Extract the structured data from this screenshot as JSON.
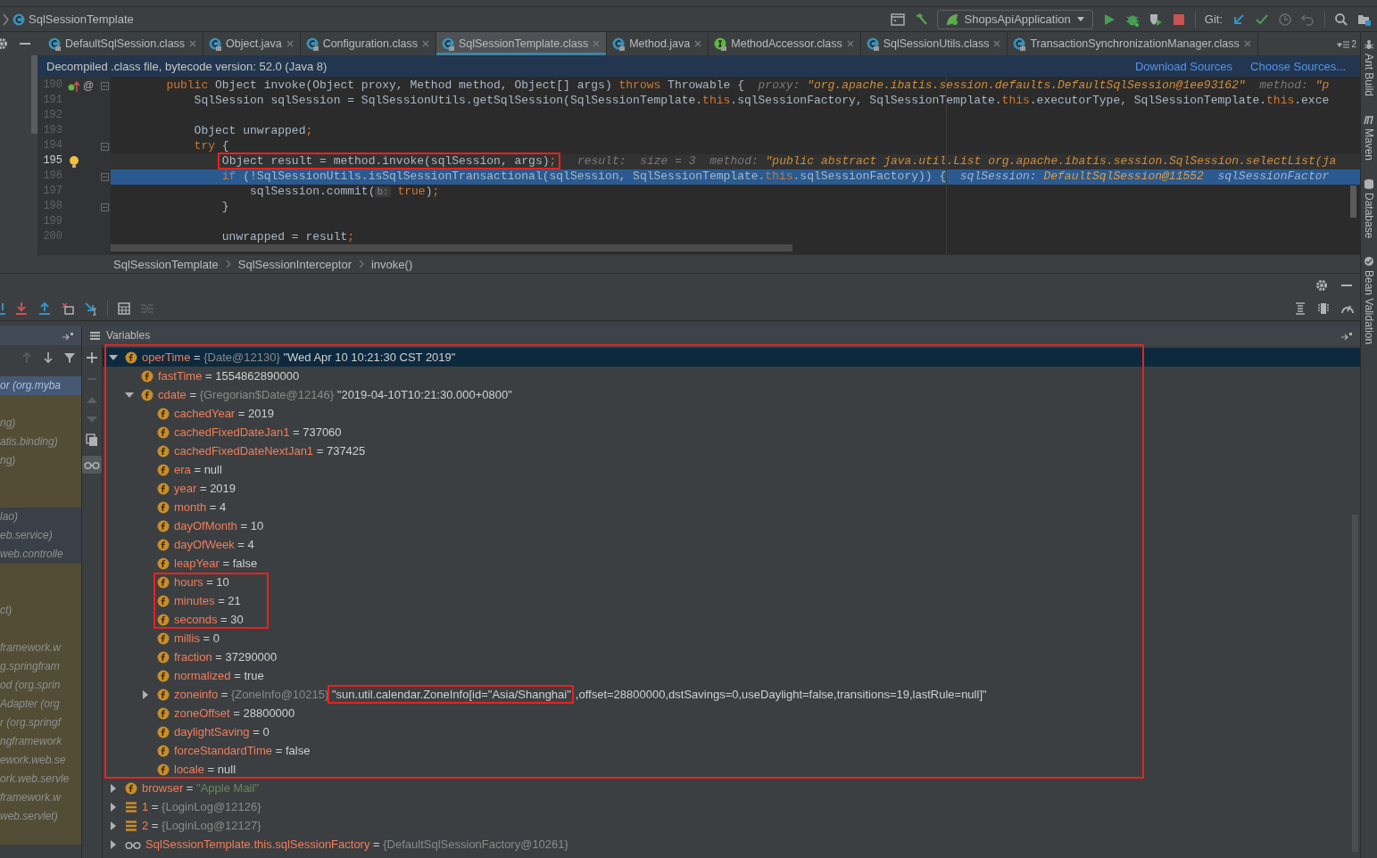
{
  "navbar": {
    "breadcrumb": "SqlSessionTemplate",
    "run_config": "ShopsApiApplication",
    "vcs_label": "Git:"
  },
  "tabs": [
    {
      "label": "DefaultSqlSession.class",
      "kind": "class",
      "selected": false
    },
    {
      "label": "Object.java",
      "kind": "class",
      "selected": false
    },
    {
      "label": "Configuration.class",
      "kind": "class",
      "selected": false
    },
    {
      "label": "SqlSessionTemplate.class",
      "kind": "class",
      "selected": true
    },
    {
      "label": "Method.java",
      "kind": "class",
      "selected": false
    },
    {
      "label": "MethodAccessor.class",
      "kind": "interface",
      "selected": false
    },
    {
      "label": "SqlSessionUtils.class",
      "kind": "class",
      "selected": false
    },
    {
      "label": "TransactionSynchronizationManager.class",
      "kind": "class",
      "selected": false
    }
  ],
  "hidden_tabs_count": "2",
  "banner": {
    "message": "Decompiled .class file, bytecode version: 52.0 (Java 8)",
    "links": [
      "Download Sources",
      "Choose Sources..."
    ]
  },
  "code_lines": [
    {
      "number": "190",
      "override": true,
      "gutter_mark": "@",
      "fold": true,
      "current": false,
      "execution_point": false,
      "segments": [
        {
          "kind": "keyword",
          "text": "        public"
        },
        {
          "kind": "plain",
          "text": " Object invoke(Object proxy, Method method, Object[] args) "
        },
        {
          "kind": "keyword",
          "text": "throws"
        },
        {
          "kind": "plain",
          "text": " Throwable {"
        },
        {
          "kind": "hint",
          "text": "  proxy: "
        },
        {
          "kind": "hint_value",
          "text": "\"org.apache.ibatis.session.defaults.DefaultSqlSession@1ee93162\""
        },
        {
          "kind": "hint",
          "text": "  method: "
        },
        {
          "kind": "hint_value",
          "text": "\"p"
        }
      ]
    },
    {
      "number": "191",
      "fold": false,
      "current": false,
      "execution_point": false,
      "segments": [
        {
          "kind": "plain",
          "text": "            SqlSession sqlSession = SqlSessionUtils.getSqlSession(SqlSessionTemplate."
        },
        {
          "kind": "keyword",
          "text": "this"
        },
        {
          "kind": "plain",
          "text": ".sqlSessionFactory, SqlSessionTemplate."
        },
        {
          "kind": "keyword",
          "text": "this"
        },
        {
          "kind": "plain",
          "text": ".executorType, SqlSessionTemplate."
        },
        {
          "kind": "keyword",
          "text": "this"
        },
        {
          "kind": "plain",
          "text": ".exce"
        }
      ]
    },
    {
      "number": "192"
    },
    {
      "number": "193",
      "fold": false,
      "current": false,
      "execution_point": false,
      "segments": [
        {
          "kind": "plain",
          "text": "            Object unwrapped"
        },
        {
          "kind": "keyword",
          "text": ";"
        }
      ]
    },
    {
      "number": "194",
      "fold": true,
      "current": false,
      "execution_point": false,
      "segments": [
        {
          "kind": "keyword",
          "text": "            try"
        },
        {
          "kind": "plain",
          "text": " {"
        }
      ]
    },
    {
      "number": "195",
      "intention": true,
      "fold": false,
      "current": true,
      "execution_point": false,
      "segments": [
        {
          "kind": "plain",
          "text": "                Object result = method.invoke(sqlSession, args)",
          "boxed": true
        },
        {
          "kind": "keyword",
          "text": ";",
          "boxed": true
        },
        {
          "kind": "hint",
          "text": "  result:  size = 3  method: "
        },
        {
          "kind": "hint_value",
          "text": "\"public abstract java.util.List org.apache.ibatis.session.SqlSession.selectList(ja"
        }
      ]
    },
    {
      "number": "196",
      "fold": true,
      "current": false,
      "execution_point": true,
      "segments": [
        {
          "kind": "keyword",
          "text": "                if"
        },
        {
          "kind": "plain",
          "text": " (!SqlSessionUtils.isSqlSessionTransactional(sqlSession, SqlSessionTemplate."
        },
        {
          "kind": "keyword",
          "text": "this"
        },
        {
          "kind": "plain",
          "text": ".sqlSessionFactory)) {"
        },
        {
          "kind": "hint",
          "text": "  sqlSession: "
        },
        {
          "kind": "hint_value",
          "text": "DefaultSqlSession@11552"
        },
        {
          "kind": "hint",
          "text": "  sqlSessionFactor"
        }
      ]
    },
    {
      "number": "197",
      "fold": false,
      "current": false,
      "execution_point": false,
      "segments": [
        {
          "kind": "plain",
          "text": "                    sqlSession.commit("
        },
        {
          "kind": "param_hint",
          "text": "b:"
        },
        {
          "kind": "keyword",
          "text": " true"
        },
        {
          "kind": "plain",
          "text": ")"
        },
        {
          "kind": "keyword",
          "text": ";"
        }
      ]
    },
    {
      "number": "198",
      "fold": true,
      "current": false,
      "execution_point": false,
      "segments": [
        {
          "kind": "plain",
          "text": "                }"
        }
      ]
    },
    {
      "number": "199"
    },
    {
      "number": "200",
      "fold": false,
      "current": false,
      "execution_point": false,
      "segments": [
        {
          "kind": "plain",
          "text": "                unwrapped = result"
        },
        {
          "kind": "keyword",
          "text": ";"
        }
      ]
    }
  ],
  "breadcrumbs": [
    "SqlSessionTemplate",
    "SqlSessionInterceptor",
    "invoke()"
  ],
  "variables_title": "Variables",
  "frames": [
    {
      "text": "or (org.myba",
      "library": false,
      "selected": true
    },
    {
      "library": true,
      "selected": false
    },
    {
      "text": "ng)",
      "library": true,
      "selected": false
    },
    {
      "text": "atis.binding)",
      "library": true,
      "selected": false
    },
    {
      "text": "ng)",
      "library": true,
      "selected": false
    },
    {
      "library": true,
      "selected": false
    },
    {
      "library": true,
      "selected": false
    },
    {
      "text": "lao)",
      "library": false,
      "selected": false
    },
    {
      "text": "eb.service)",
      "library": false,
      "selected": false
    },
    {
      "text": "web.controlle",
      "library": false,
      "selected": false
    },
    {
      "library": true,
      "selected": false
    },
    {
      "library": true,
      "selected": false
    },
    {
      "text": "ct)",
      "library": true,
      "selected": false
    },
    {
      "library": true,
      "selected": false
    },
    {
      "text": "framework.w",
      "library": true,
      "selected": false
    },
    {
      "text": "g.springfram",
      "library": true,
      "selected": false
    },
    {
      "text": "od (org.sprin",
      "library": true,
      "selected": false
    },
    {
      "text": "Adapter (org",
      "library": true,
      "selected": false
    },
    {
      "text": "r (org.springf",
      "library": true,
      "selected": false
    },
    {
      "text": "ngframework",
      "library": true,
      "selected": false
    },
    {
      "text": "ework.web.se",
      "library": true,
      "selected": false
    },
    {
      "text": "ork.web.servle",
      "library": true,
      "selected": false
    },
    {
      "text": "framework.w",
      "library": true,
      "selected": false
    },
    {
      "text": "web.servlet)",
      "library": true,
      "selected": false
    },
    {
      "library": true,
      "selected": false
    }
  ],
  "variables": {
    "separator": "=",
    "items": [
      {
        "children": [
          {
            "children": [
              {
                "name": "operTime",
                "type": "{Date@12130}",
                "value": "\"Wed Apr 10 10:21:30 CST 2019\"",
                "kind": "field",
                "expanded": true,
                "selected": true,
                "highlight_subtree": true,
                "children": [
                  {
                    "name": "fastTime",
                    "value": "1554862890000",
                    "kind": "field",
                    "selected": false
                  },
                  {
                    "name": "cdate",
                    "type": "{Gregorian$Date@12146}",
                    "value": "\"2019-04-10T10:21:30.000+0800\"",
                    "kind": "field",
                    "expanded": true,
                    "selected": false,
                    "children": [
                      {
                        "name": "cachedYear",
                        "value": "2019",
                        "kind": "field",
                        "selected": false
                      },
                      {
                        "name": "cachedFixedDateJan1",
                        "value": "737060",
                        "kind": "field",
                        "selected": false
                      },
                      {
                        "name": "cachedFixedDateNextJan1",
                        "value": "737425",
                        "kind": "field",
                        "selected": false
                      },
                      {
                        "name": "era",
                        "value": "null",
                        "kind": "field",
                        "selected": false
                      },
                      {
                        "name": "year",
                        "value": "2019",
                        "kind": "field",
                        "selected": false
                      },
                      {
                        "name": "month",
                        "value": "4",
                        "kind": "field",
                        "selected": false
                      },
                      {
                        "name": "dayOfMonth",
                        "value": "10",
                        "kind": "field",
                        "selected": false
                      },
                      {
                        "name": "dayOfWeek",
                        "value": "4",
                        "kind": "field",
                        "selected": false
                      },
                      {
                        "name": "leapYear",
                        "value": "false",
                        "kind": "field",
                        "selected": false
                      },
                      {
                        "name": "hours",
                        "value": "10",
                        "kind": "field",
                        "selected": false,
                        "highlighted": true
                      },
                      {
                        "name": "minutes",
                        "value": "21",
                        "kind": "field",
                        "selected": false,
                        "highlighted": true
                      },
                      {
                        "name": "seconds",
                        "value": "30",
                        "kind": "field",
                        "selected": false,
                        "highlighted": true
                      },
                      {
                        "name": "millis",
                        "value": "0",
                        "kind": "field",
                        "selected": false
                      },
                      {
                        "name": "fraction",
                        "value": "37290000",
                        "kind": "field",
                        "selected": false
                      },
                      {
                        "name": "normalized",
                        "value": "true",
                        "kind": "field",
                        "selected": false
                      },
                      {
                        "name": "zoneinfo",
                        "type": "{ZoneInfo@10215}",
                        "value": "\"sun.util.calendar.ZoneInfo[id=\"Asia/Shanghai\"",
                        "value_rest": ",offset=28800000,dstSavings=0,useDaylight=false,transitions=19,lastRule=null]\"",
                        "value_highlight": true,
                        "kind": "field",
                        "expanded": false,
                        "selected": false
                      },
                      {
                        "name": "zoneOffset",
                        "value": "28800000",
                        "kind": "field",
                        "selected": false
                      },
                      {
                        "name": "daylightSaving",
                        "value": "0",
                        "kind": "field",
                        "selected": false
                      },
                      {
                        "name": "forceStandardTime",
                        "value": "false",
                        "kind": "field",
                        "selected": false
                      },
                      {
                        "name": "locale",
                        "value": "null",
                        "kind": "field",
                        "selected": false
                      }
                    ]
                  }
                ]
              },
              {
                "name": "browser",
                "value": "\"Apple Mail\"",
                "string_value": true,
                "kind": "field",
                "expanded": false,
                "selected": false
              }
            ]
          },
          {
            "name": "1",
            "type": "{LoginLog@12126}",
            "kind": "element",
            "expanded": false,
            "selected": false
          },
          {
            "name": "2",
            "type": "{LoginLog@12127}",
            "kind": "element",
            "expanded": false,
            "selected": false
          }
        ]
      },
      {
        "name": "SqlSessionTemplate.this.sqlSessionFactory",
        "type": "{DefaultSqlSessionFactory@10261}",
        "kind": "watch",
        "expanded": false,
        "selected": false
      }
    ]
  },
  "side_tools": [
    {
      "label": "Ant Build",
      "kind": "ant"
    },
    {
      "label": "Maven",
      "kind": "maven"
    },
    {
      "label": "Database",
      "kind": "database"
    },
    {
      "label": "Bean Validation",
      "kind": "bean"
    }
  ]
}
